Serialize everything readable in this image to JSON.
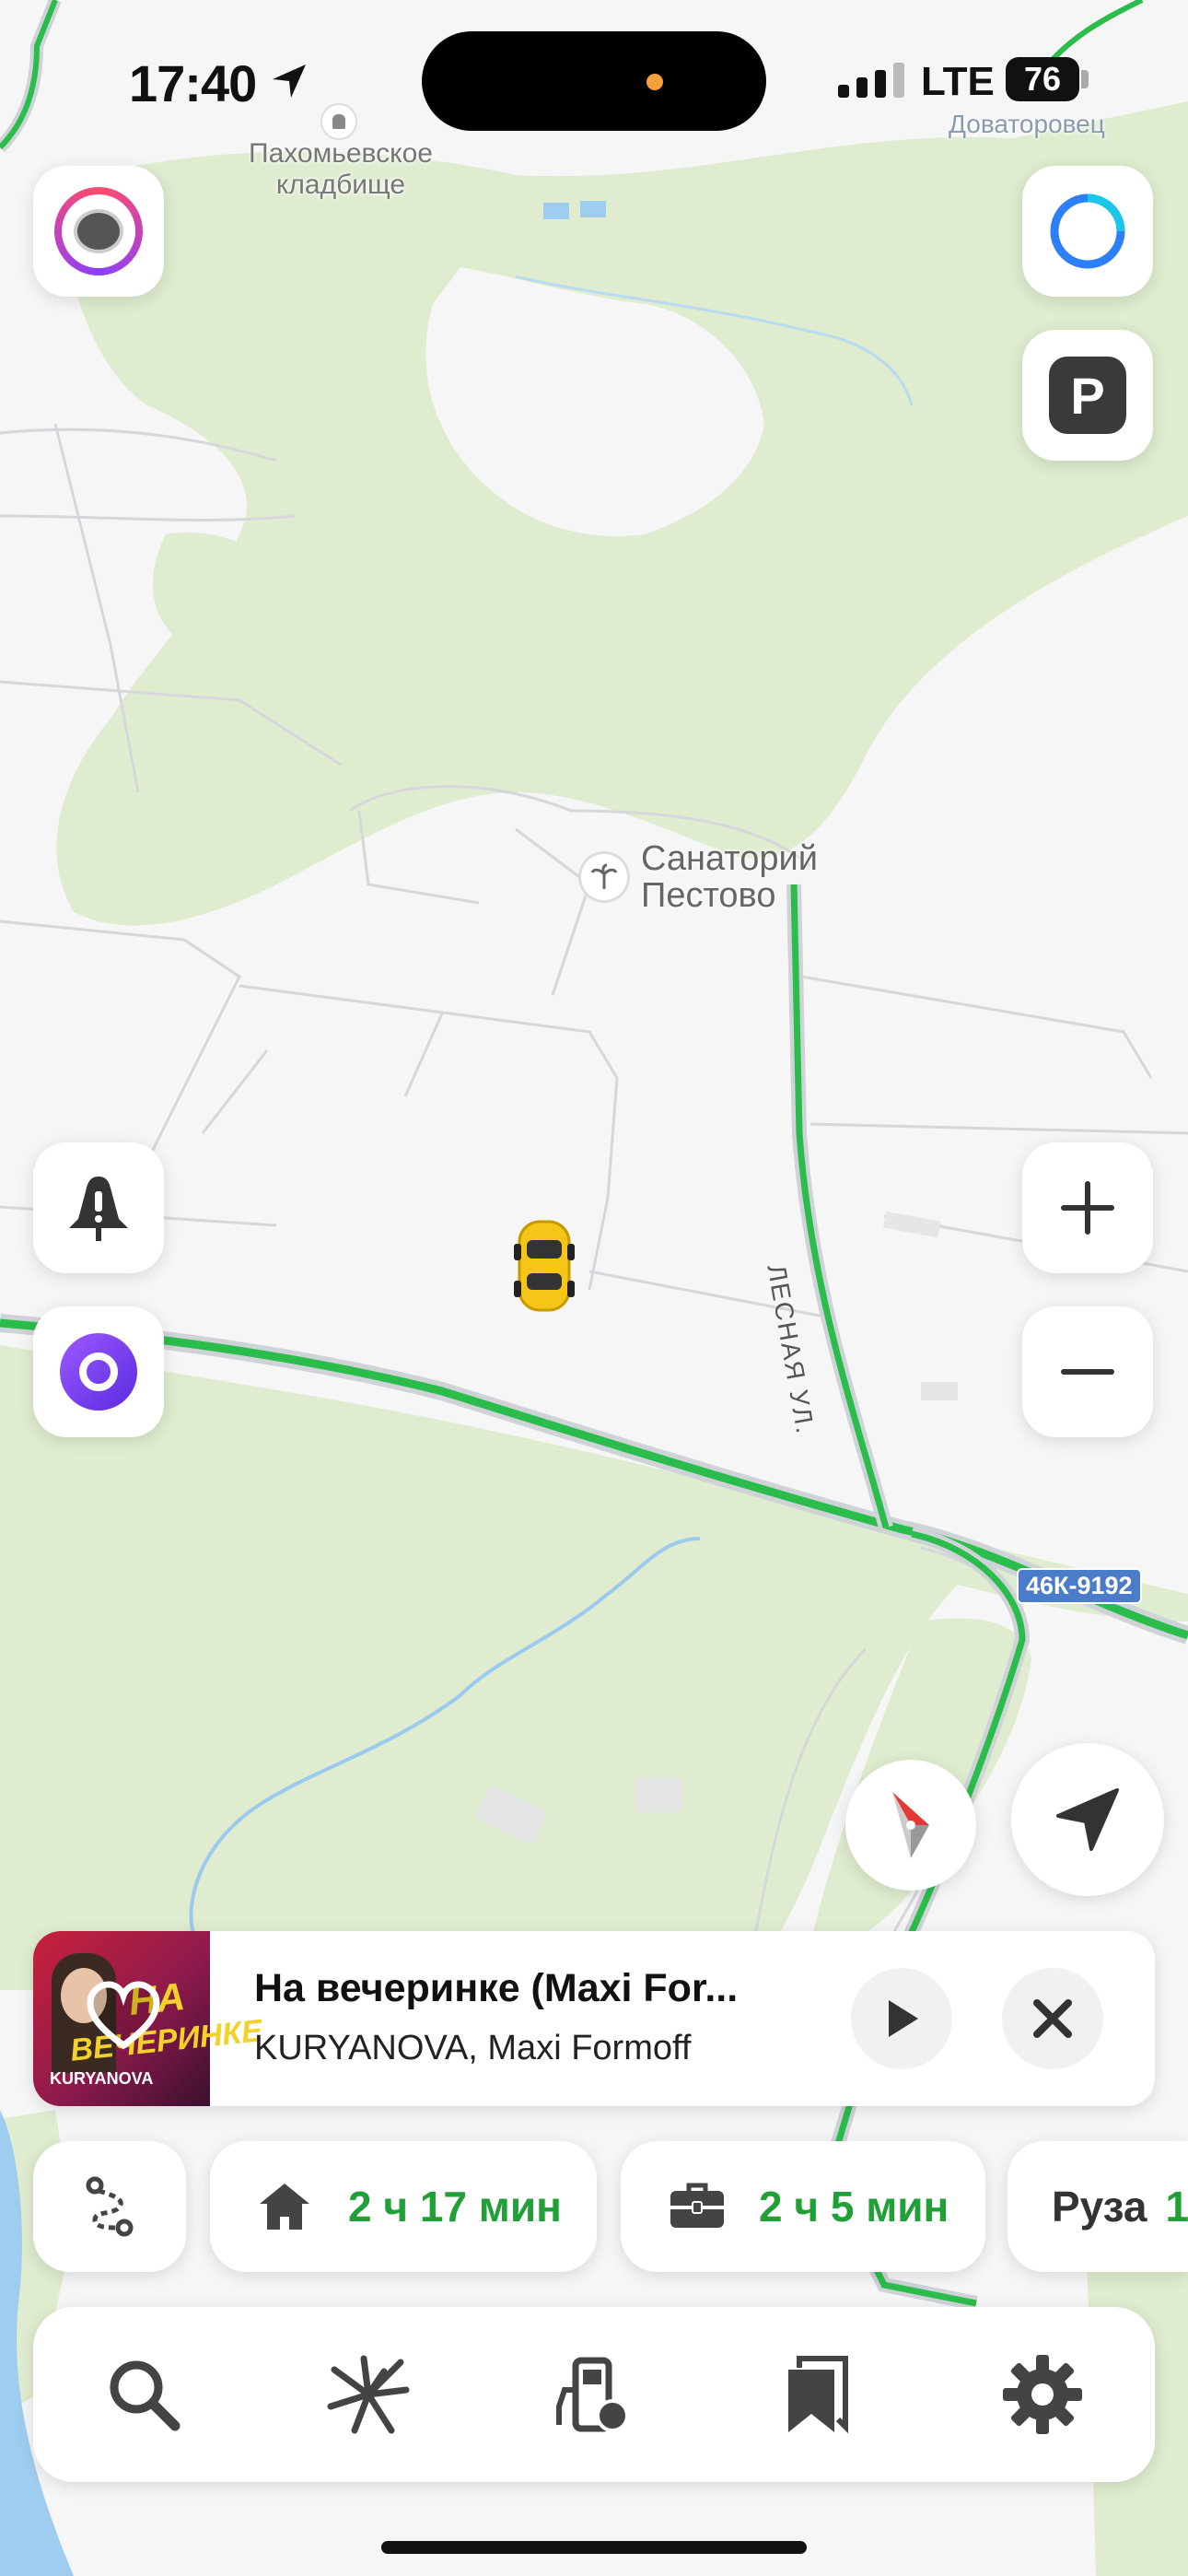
{
  "status_bar": {
    "time": "17:40",
    "network": "LTE",
    "battery": "76"
  },
  "map": {
    "labels": {
      "cemetery": "Пахомьевское\nкладбище",
      "village": "Доваторовец",
      "sanatorium": "Санаторий\nПестово",
      "street": "ЛЕСНАЯ УЛ.",
      "road_badge": "46К-9192"
    }
  },
  "music": {
    "title": "На вечеринке (Maxi For...",
    "artist": "KURYANOVA, Maxi Formoff",
    "album_text_1": "НА",
    "album_text_2": "ВЕЧЕРИНКЕ",
    "album_artist": "KURYANOVA"
  },
  "quick_routes": {
    "home_time": "2 ч 17 мин",
    "work_time": "2 ч 5 мин",
    "destination": "Руза"
  },
  "colors": {
    "accent_green": "#21a038",
    "road_green": "#2bbd4b",
    "alice_purple": "#7b3ff2",
    "parking_dark": "#3a3a3a",
    "compass_red": "#e53935"
  },
  "icons": [
    "navigation-arrow-icon",
    "signal-icon",
    "avatar-icon",
    "alice-circle-icon",
    "parking-icon",
    "report-alert-icon",
    "alice-icon",
    "zoom-in-icon",
    "zoom-out-icon",
    "compass-icon",
    "locate-me-icon",
    "heart-icon",
    "play-icon",
    "close-icon",
    "routes-icon",
    "home-icon",
    "briefcase-icon",
    "search-icon",
    "discover-icon",
    "fuel-icon",
    "bookmarks-icon",
    "settings-icon"
  ]
}
